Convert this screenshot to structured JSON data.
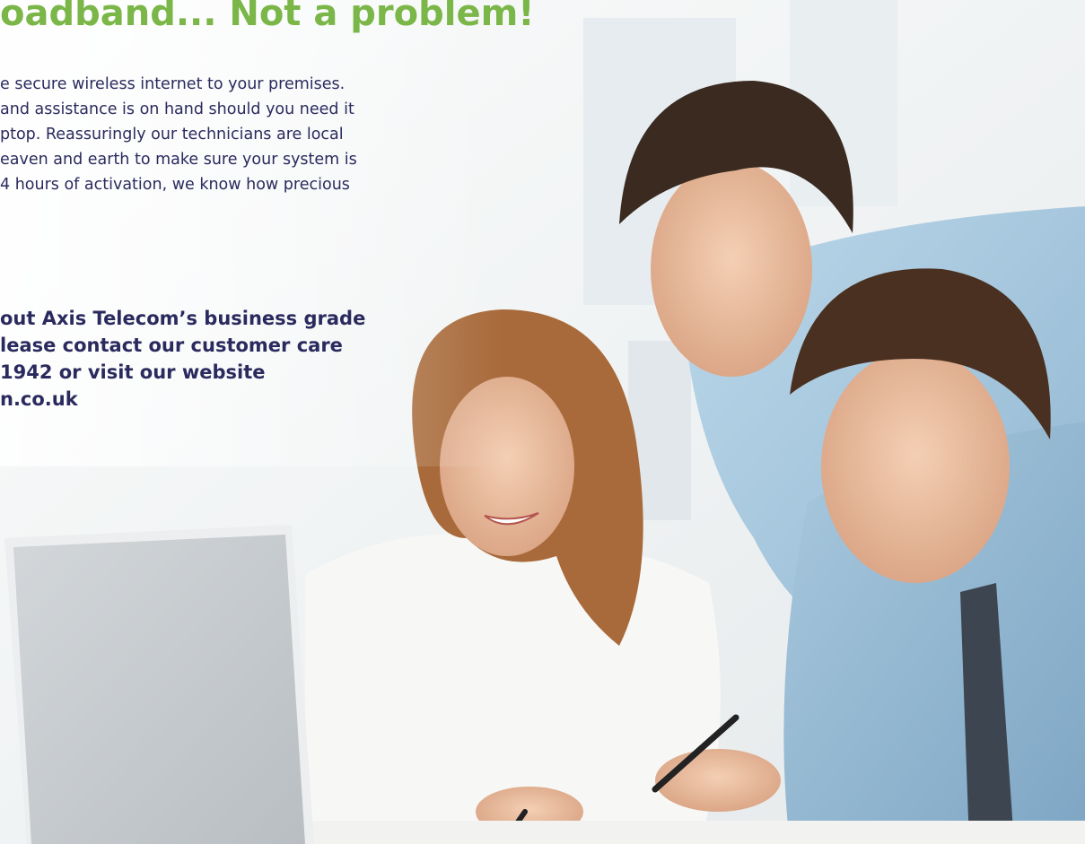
{
  "headline": "oadband... Not a problem!",
  "body_lines": [
    "e secure wireless internet to your premises.",
    " and assistance is on hand should you need it",
    "ptop. Reassuringly our technicians are local",
    "eaven and earth to make sure your system is",
    "4 hours of activation, we know how precious"
  ],
  "cta_lines": [
    "out Axis Telecom’s business grade",
    "lease contact our customer care",
    "1942 or visit our website",
    "n.co.uk"
  ],
  "colors": {
    "headline": "#7ab648",
    "text": "#2b2a5e",
    "background": "#f4f6f7"
  }
}
